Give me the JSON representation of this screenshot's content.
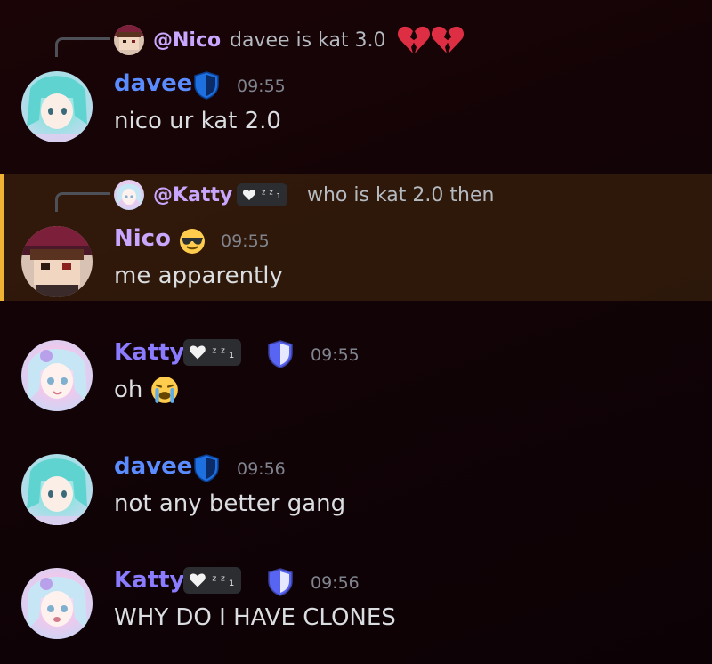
{
  "colors": {
    "davee": "#5b8cff",
    "nico": "#c9a7ff",
    "katty": "#8b7bff",
    "highlight_bar": "#f0b232"
  },
  "messages": [
    {
      "reply": {
        "username": "@Nico",
        "text": "davee is kat 3.0",
        "emoji": "broken-heart"
      },
      "username": "davee",
      "badge": "shield-icon",
      "time": "09:55",
      "text": "nico ur kat 2.0"
    },
    {
      "reply": {
        "username": "@Katty",
        "tag": "ᶻᶻ₁",
        "text": "who is kat 2.0 then"
      },
      "username": "Nico",
      "emoji": "sunglasses-face",
      "time": "09:55",
      "text": "me apparently",
      "highlighted": true
    },
    {
      "username": "Katty",
      "tag": "ᶻᶻ₁",
      "badge": "shield-icon",
      "time": "09:55",
      "text": "oh",
      "emoji": "loudly-crying-face"
    },
    {
      "username": "davee",
      "badge": "shield-icon",
      "time": "09:56",
      "text": "not any better gang"
    },
    {
      "username": "Katty",
      "tag": "ᶻᶻ₁",
      "badge": "shield-icon",
      "time": "09:56",
      "text": "WHY DO I HAVE CLONES"
    }
  ]
}
